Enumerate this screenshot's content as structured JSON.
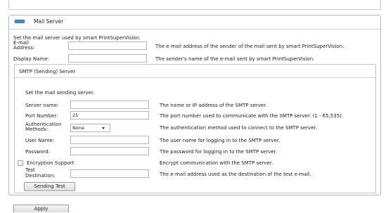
{
  "mail_server": {
    "title": "Mail Server",
    "intro": "Set the mail server used by smart PrintSuperVision.",
    "email_address": {
      "label_line1": "E-mail",
      "label_line2": "Address:",
      "value": "",
      "description": "The e-mail address of the sender of the mail sent by smart PrintSuperVision."
    },
    "display_name": {
      "label": "Display Name:",
      "value": "",
      "description": "The sender's name of the e-mail sent by smart PrintSuperVision."
    }
  },
  "smtp": {
    "title": "SMTP (Sending) Server",
    "intro": "Set the mail sending server.",
    "server_name": {
      "label": "Server name:",
      "value": "",
      "description": "The name or IP address of the SMTP server."
    },
    "port_number": {
      "label": "Port Number:",
      "value": "25",
      "description": "The port number used to communicate with the SMTP server. (1 - 65,535)"
    },
    "auth_method": {
      "label_line1": "Authentication",
      "label_line2": "Methods:",
      "selected": "None",
      "description": "The authentication method used to connect to the SMTP server."
    },
    "user_name": {
      "label": "User Name:",
      "value": "",
      "description": "The user name for logging in to the SMTP server."
    },
    "password": {
      "label": "Password:",
      "value": "",
      "description": "The password for logging in to the SMTP server."
    },
    "encryption": {
      "label": "Encryption Support",
      "checked": false,
      "description": "Encrypt communication with the SMTP server."
    },
    "test_destination": {
      "label_line1": "Test",
      "label_line2": "Destination:",
      "value": "",
      "description": "The e-mail address used as the destination of the test e-mail."
    },
    "sending_test_label": "Sending Test"
  },
  "apply_label": "Apply",
  "colors": {
    "header_icon": "#3a8fd6",
    "border": "#b8b8b8"
  },
  "icons": {
    "header": "mail-server-icon",
    "dropdown": "chevron-down-icon"
  }
}
